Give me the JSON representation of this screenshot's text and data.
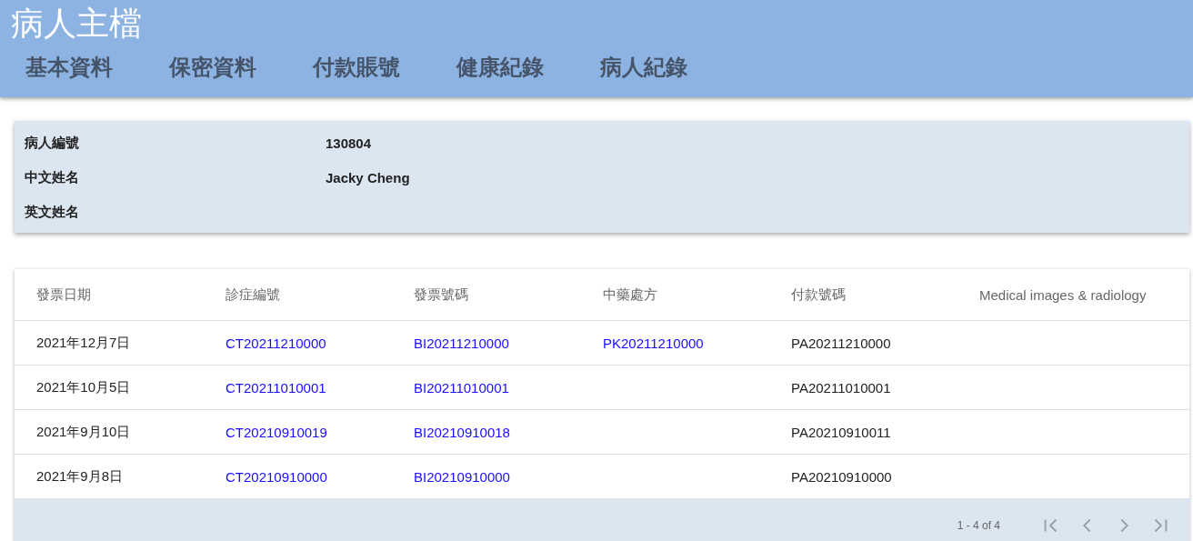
{
  "header": {
    "title": "病人主檔",
    "tabs": [
      {
        "label": "基本資料"
      },
      {
        "label": "保密資料"
      },
      {
        "label": "付款賬號"
      },
      {
        "label": "健康紀錄"
      },
      {
        "label": "病人紀錄"
      }
    ]
  },
  "patient": {
    "fields": [
      {
        "label": "病人編號",
        "value": "130804"
      },
      {
        "label": "中文姓名",
        "value": "Jacky Cheng"
      },
      {
        "label": "英文姓名"
      }
    ]
  },
  "table": {
    "columns": [
      "發票日期",
      "診症編號",
      "發票號碼",
      "中藥處方",
      "付款號碼",
      "Medical images & radiology"
    ],
    "rows": [
      [
        {
          "text": "2021年12月7日",
          "kind": "plain"
        },
        {
          "text": "CT20211210000",
          "kind": "link"
        },
        {
          "text": "BI20211210000",
          "kind": "link"
        },
        {
          "text": "PK20211210000",
          "kind": "link"
        },
        {
          "text": "PA20211210000",
          "kind": "plain"
        },
        null
      ],
      [
        {
          "text": "2021年10月5日",
          "kind": "plain"
        },
        {
          "text": "CT20211010001",
          "kind": "link"
        },
        {
          "text": "BI20211010001",
          "kind": "link"
        },
        null,
        {
          "text": "PA20211010001",
          "kind": "plain"
        },
        null
      ],
      [
        {
          "text": "2021年9月10日",
          "kind": "plain"
        },
        {
          "text": "CT20210910019",
          "kind": "link"
        },
        {
          "text": "BI20210910018",
          "kind": "link"
        },
        null,
        {
          "text": "PA20210910011",
          "kind": "plain"
        },
        null
      ],
      [
        {
          "text": "2021年9月8日",
          "kind": "plain"
        },
        {
          "text": "CT20210910000",
          "kind": "link"
        },
        {
          "text": "BI20210910000",
          "kind": "link"
        },
        null,
        {
          "text": "PA20210910000",
          "kind": "plain"
        },
        null
      ]
    ],
    "pager": {
      "range": "1 - 4 of 4",
      "buttons": [
        {
          "kind": "first",
          "disabled": true
        },
        {
          "kind": "prev",
          "disabled": true
        },
        {
          "kind": "next",
          "disabled": true
        },
        {
          "kind": "last",
          "disabled": true
        }
      ]
    }
  }
}
